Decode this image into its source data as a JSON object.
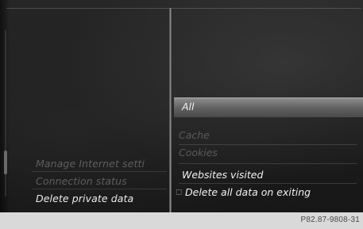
{
  "left_menu": {
    "items": [
      {
        "label": "Manage Internet setti",
        "state": "disabled"
      },
      {
        "label": "Connection status",
        "state": "disabled"
      },
      {
        "label": "Delete private data",
        "state": "active"
      }
    ]
  },
  "submenu": {
    "items": [
      {
        "label": "All",
        "state": "selected"
      },
      {
        "label": "Cache",
        "state": "disabled"
      },
      {
        "label": "Cookies",
        "state": "disabled"
      },
      {
        "label": "Websites visited",
        "state": "active"
      },
      {
        "label": "Delete all data on exiting",
        "state": "active",
        "checkbox": "unchecked"
      }
    ]
  },
  "footer": {
    "figure_code": "P82.87-9808-31"
  },
  "colors": {
    "screen_bg": "#1e1e1e",
    "highlight": "#7a7a7a",
    "active_text": "#ececec",
    "disabled_text": "#5e5e5e",
    "footer_bg": "#d9d9d9"
  }
}
